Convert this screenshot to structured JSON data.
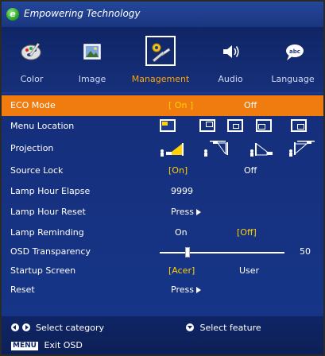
{
  "header": {
    "logo_letter": "e",
    "tagline": "Empowering Technology"
  },
  "tabs": [
    {
      "label": "Color",
      "icon": "color-palette-icon"
    },
    {
      "label": "Image",
      "icon": "image-icon"
    },
    {
      "label": "Management",
      "icon": "tools-icon",
      "active": true
    },
    {
      "label": "Audio",
      "icon": "speaker-icon"
    },
    {
      "label": "Language",
      "icon": "language-bubble-icon"
    }
  ],
  "menu": {
    "eco_mode": {
      "label": "ECO Mode",
      "on": "[ On ]",
      "off": "Off"
    },
    "menu_location": {
      "label": "Menu Location"
    },
    "projection": {
      "label": "Projection"
    },
    "source_lock": {
      "label": "Source Lock",
      "on": "[On]",
      "off": "Off"
    },
    "lamp_hour_elapse": {
      "label": "Lamp Hour Elapse",
      "value": "9999"
    },
    "lamp_hour_reset": {
      "label": "Lamp Hour Reset",
      "action": "Press"
    },
    "lamp_reminding": {
      "label": "Lamp Reminding",
      "on": "On",
      "off": "[Off]"
    },
    "osd_transparency": {
      "label": "OSD Transparency",
      "value": "50",
      "level_fraction": 0.22
    },
    "startup_screen": {
      "label": "Startup Screen",
      "acer": "[Acer]",
      "user": "User"
    },
    "reset": {
      "label": "Reset",
      "action": "Press"
    }
  },
  "footer": {
    "select_category": "Select category",
    "select_feature": "Select feature",
    "menu_key": "MENU",
    "exit": "Exit OSD"
  },
  "colors": {
    "background": "#1e3a8c",
    "highlight": "#f07c10",
    "selected_value": "#ffd200",
    "active_tab_label": "#ffa500"
  }
}
